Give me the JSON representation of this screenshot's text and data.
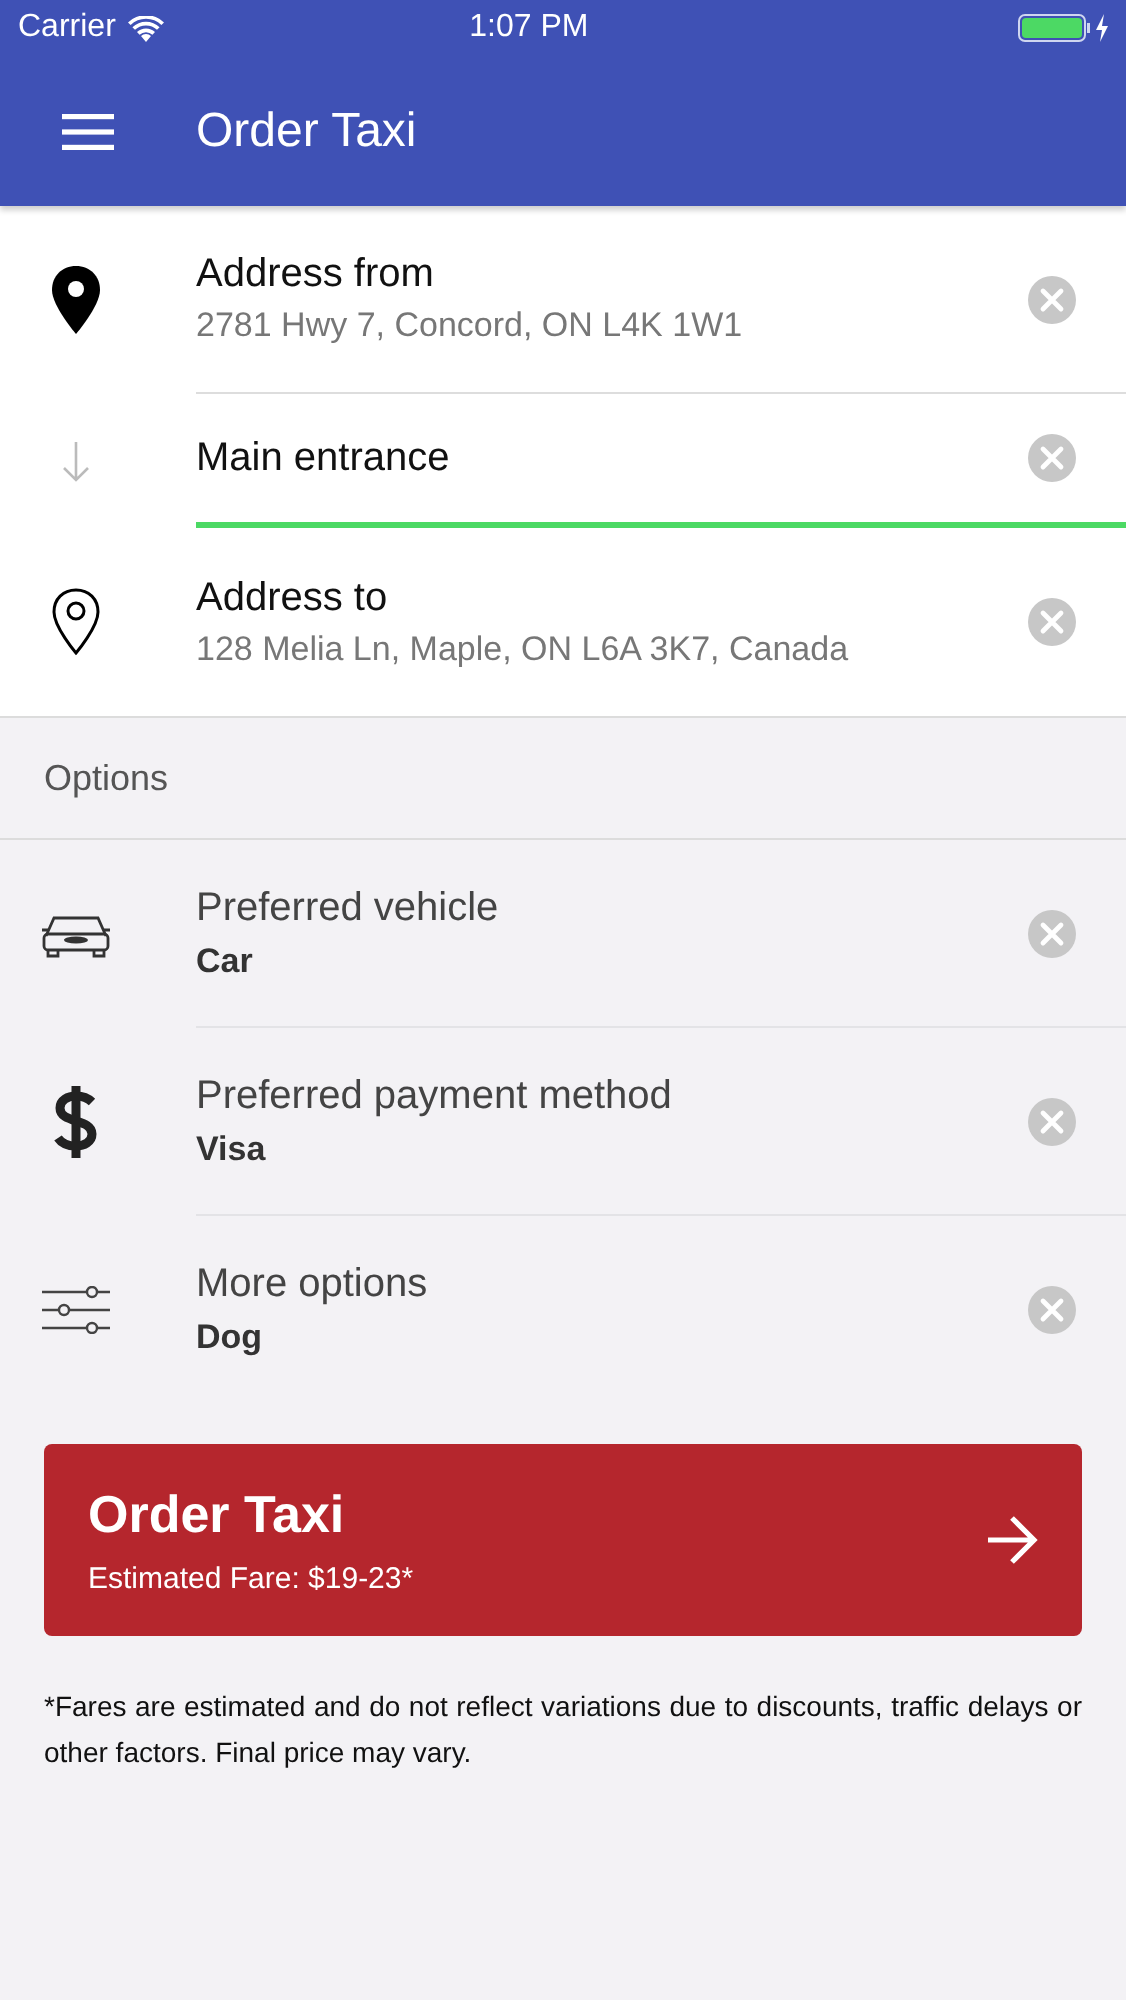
{
  "status_bar": {
    "carrier": "Carrier",
    "time": "1:07 PM"
  },
  "app_bar": {
    "title": "Order Taxi"
  },
  "addresses": [
    {
      "kind": "from",
      "label": "Address from",
      "value": "2781 Hwy 7, Concord, ON L4K 1W1"
    },
    {
      "kind": "entrance",
      "value": "Main entrance",
      "focused": true
    },
    {
      "kind": "to",
      "label": "Address to",
      "value": "128 Melia Ln, Maple, ON L6A 3K7, Canada"
    }
  ],
  "options_header": "Options",
  "options": [
    {
      "kind": "vehicle",
      "label": "Preferred vehicle",
      "value": "Car"
    },
    {
      "kind": "payment",
      "label": "Preferred payment method",
      "value": "Visa"
    },
    {
      "kind": "more",
      "label": "More options",
      "value": "Dog"
    }
  ],
  "order_button": {
    "title": "Order Taxi",
    "fare": "Estimated Fare: $19-23*"
  },
  "footnote": "*Fares are estimated and do not reflect variations due to discounts, traffic delays or other factors. Final price may vary."
}
